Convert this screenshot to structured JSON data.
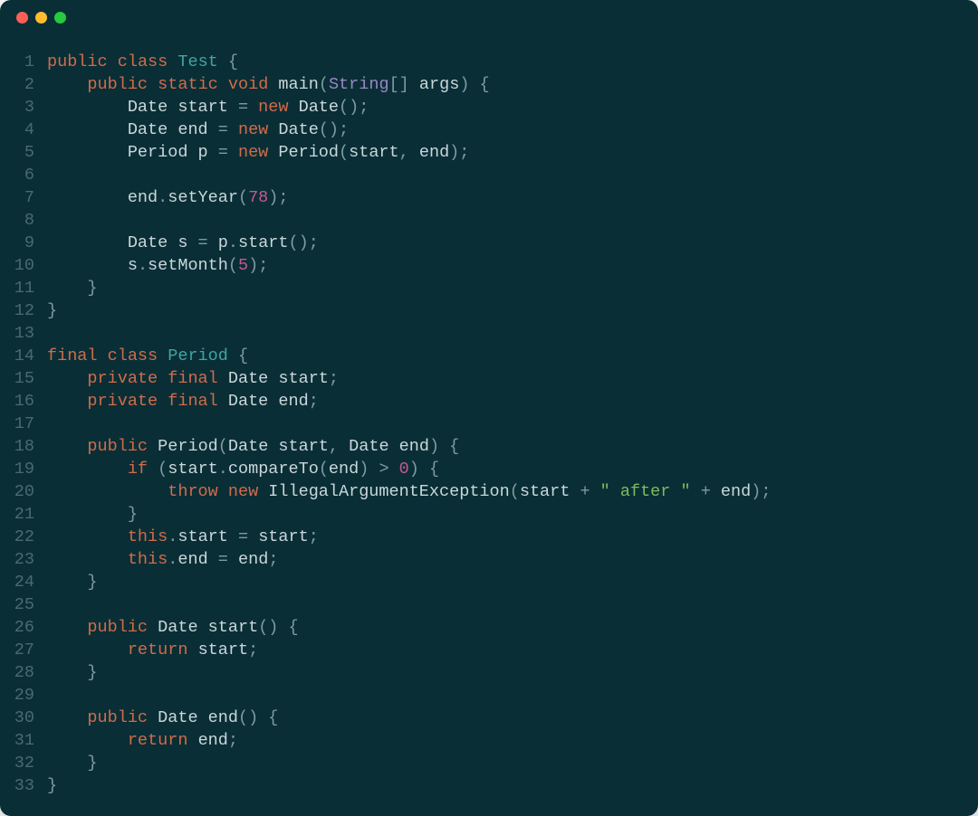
{
  "colors": {
    "bg": "#0a2e36",
    "gutter": "#4a6a72",
    "text": "#c9d7da",
    "keyword": "#d06c4a",
    "type": "#3fa5a3",
    "type2": "#9a87c4",
    "punct": "#7f9ba1",
    "number": "#c55a8a",
    "string": "#7bbd5d",
    "dot_red": "#ff5f56",
    "dot_yellow": "#ffbd2e",
    "dot_green": "#27c93f"
  },
  "code_lines": [
    {
      "n": "1",
      "tokens": [
        [
          "kw",
          "public"
        ],
        [
          "",
          ""
        ],
        [
          "punc",
          " "
        ],
        [
          "kw",
          "class"
        ],
        [
          "punc",
          " "
        ],
        [
          "type",
          "Test"
        ],
        [
          "punc",
          " {"
        ]
      ]
    },
    {
      "n": "2",
      "tokens": [
        [
          "",
          "    "
        ],
        [
          "kw",
          "public"
        ],
        [
          "punc",
          " "
        ],
        [
          "kw",
          "static"
        ],
        [
          "punc",
          " "
        ],
        [
          "kw",
          "void"
        ],
        [
          "punc",
          " "
        ],
        [
          "ident",
          "main"
        ],
        [
          "punc",
          "("
        ],
        [
          "type2",
          "String"
        ],
        [
          "punc",
          "[] "
        ],
        [
          "ident",
          "args"
        ],
        [
          "punc",
          ") {"
        ]
      ]
    },
    {
      "n": "3",
      "tokens": [
        [
          "",
          "        "
        ],
        [
          "ident",
          "Date start "
        ],
        [
          "punc",
          "= "
        ],
        [
          "kw",
          "new"
        ],
        [
          "punc",
          " "
        ],
        [
          "ident",
          "Date"
        ],
        [
          "punc",
          "();"
        ]
      ]
    },
    {
      "n": "4",
      "tokens": [
        [
          "",
          "        "
        ],
        [
          "ident",
          "Date end "
        ],
        [
          "punc",
          "= "
        ],
        [
          "kw",
          "new"
        ],
        [
          "punc",
          " "
        ],
        [
          "ident",
          "Date"
        ],
        [
          "punc",
          "();"
        ]
      ]
    },
    {
      "n": "5",
      "tokens": [
        [
          "",
          "        "
        ],
        [
          "ident",
          "Period p "
        ],
        [
          "punc",
          "= "
        ],
        [
          "kw",
          "new"
        ],
        [
          "punc",
          " "
        ],
        [
          "ident",
          "Period"
        ],
        [
          "punc",
          "("
        ],
        [
          "ident",
          "start"
        ],
        [
          "punc",
          ", "
        ],
        [
          "ident",
          "end"
        ],
        [
          "punc",
          ");"
        ]
      ]
    },
    {
      "n": "6",
      "tokens": [
        [
          "",
          ""
        ]
      ]
    },
    {
      "n": "7",
      "tokens": [
        [
          "",
          "        "
        ],
        [
          "ident",
          "end"
        ],
        [
          "punc",
          "."
        ],
        [
          "ident",
          "setYear"
        ],
        [
          "punc",
          "("
        ],
        [
          "num",
          "78"
        ],
        [
          "punc",
          ");"
        ]
      ]
    },
    {
      "n": "8",
      "tokens": [
        [
          "",
          ""
        ]
      ]
    },
    {
      "n": "9",
      "tokens": [
        [
          "",
          "        "
        ],
        [
          "ident",
          "Date s "
        ],
        [
          "punc",
          "= "
        ],
        [
          "ident",
          "p"
        ],
        [
          "punc",
          "."
        ],
        [
          "ident",
          "start"
        ],
        [
          "punc",
          "();"
        ]
      ]
    },
    {
      "n": "10",
      "tokens": [
        [
          "",
          "        "
        ],
        [
          "ident",
          "s"
        ],
        [
          "punc",
          "."
        ],
        [
          "ident",
          "setMonth"
        ],
        [
          "punc",
          "("
        ],
        [
          "num",
          "5"
        ],
        [
          "punc",
          ");"
        ]
      ]
    },
    {
      "n": "11",
      "tokens": [
        [
          "",
          "    "
        ],
        [
          "punc",
          "}"
        ]
      ]
    },
    {
      "n": "12",
      "tokens": [
        [
          "punc",
          "}"
        ]
      ]
    },
    {
      "n": "13",
      "tokens": [
        [
          "",
          ""
        ]
      ]
    },
    {
      "n": "14",
      "tokens": [
        [
          "kw",
          "final"
        ],
        [
          "punc",
          " "
        ],
        [
          "kw",
          "class"
        ],
        [
          "punc",
          " "
        ],
        [
          "type",
          "Period"
        ],
        [
          "punc",
          " {"
        ]
      ]
    },
    {
      "n": "15",
      "tokens": [
        [
          "",
          "    "
        ],
        [
          "kw",
          "private"
        ],
        [
          "punc",
          " "
        ],
        [
          "kw",
          "final"
        ],
        [
          "punc",
          " "
        ],
        [
          "ident",
          "Date start"
        ],
        [
          "punc",
          ";"
        ]
      ]
    },
    {
      "n": "16",
      "tokens": [
        [
          "",
          "    "
        ],
        [
          "kw",
          "private"
        ],
        [
          "punc",
          " "
        ],
        [
          "kw",
          "final"
        ],
        [
          "punc",
          " "
        ],
        [
          "ident",
          "Date end"
        ],
        [
          "punc",
          ";"
        ]
      ]
    },
    {
      "n": "17",
      "tokens": [
        [
          "",
          ""
        ]
      ]
    },
    {
      "n": "18",
      "tokens": [
        [
          "",
          "    "
        ],
        [
          "kw",
          "public"
        ],
        [
          "punc",
          " "
        ],
        [
          "ident",
          "Period"
        ],
        [
          "punc",
          "("
        ],
        [
          "ident",
          "Date start"
        ],
        [
          "punc",
          ", "
        ],
        [
          "ident",
          "Date end"
        ],
        [
          "punc",
          ") {"
        ]
      ]
    },
    {
      "n": "19",
      "tokens": [
        [
          "",
          "        "
        ],
        [
          "kw",
          "if"
        ],
        [
          "punc",
          " ("
        ],
        [
          "ident",
          "start"
        ],
        [
          "punc",
          "."
        ],
        [
          "ident",
          "compareTo"
        ],
        [
          "punc",
          "("
        ],
        [
          "ident",
          "end"
        ],
        [
          "punc",
          ") > "
        ],
        [
          "num",
          "0"
        ],
        [
          "punc",
          ") {"
        ]
      ]
    },
    {
      "n": "20",
      "tokens": [
        [
          "",
          "            "
        ],
        [
          "kw",
          "throw"
        ],
        [
          "punc",
          " "
        ],
        [
          "kw",
          "new"
        ],
        [
          "punc",
          " "
        ],
        [
          "ident",
          "IllegalArgumentException"
        ],
        [
          "punc",
          "("
        ],
        [
          "ident",
          "start"
        ],
        [
          "punc",
          " + "
        ],
        [
          "str",
          "\" after \""
        ],
        [
          "punc",
          " + "
        ],
        [
          "ident",
          "end"
        ],
        [
          "punc",
          ");"
        ]
      ]
    },
    {
      "n": "21",
      "tokens": [
        [
          "",
          "        "
        ],
        [
          "punc",
          "}"
        ]
      ]
    },
    {
      "n": "22",
      "tokens": [
        [
          "",
          "        "
        ],
        [
          "kw",
          "this"
        ],
        [
          "punc",
          "."
        ],
        [
          "ident",
          "start "
        ],
        [
          "punc",
          "= "
        ],
        [
          "ident",
          "start"
        ],
        [
          "punc",
          ";"
        ]
      ]
    },
    {
      "n": "23",
      "tokens": [
        [
          "",
          "        "
        ],
        [
          "kw",
          "this"
        ],
        [
          "punc",
          "."
        ],
        [
          "ident",
          "end "
        ],
        [
          "punc",
          "= "
        ],
        [
          "ident",
          "end"
        ],
        [
          "punc",
          ";"
        ]
      ]
    },
    {
      "n": "24",
      "tokens": [
        [
          "",
          "    "
        ],
        [
          "punc",
          "}"
        ]
      ]
    },
    {
      "n": "25",
      "tokens": [
        [
          "",
          ""
        ]
      ]
    },
    {
      "n": "26",
      "tokens": [
        [
          "",
          "    "
        ],
        [
          "kw",
          "public"
        ],
        [
          "punc",
          " "
        ],
        [
          "ident",
          "Date "
        ],
        [
          "ident",
          "start"
        ],
        [
          "punc",
          "() {"
        ]
      ]
    },
    {
      "n": "27",
      "tokens": [
        [
          "",
          "        "
        ],
        [
          "kw",
          "return"
        ],
        [
          "punc",
          " "
        ],
        [
          "ident",
          "start"
        ],
        [
          "punc",
          ";"
        ]
      ]
    },
    {
      "n": "28",
      "tokens": [
        [
          "",
          "    "
        ],
        [
          "punc",
          "}"
        ]
      ]
    },
    {
      "n": "29",
      "tokens": [
        [
          "",
          ""
        ]
      ]
    },
    {
      "n": "30",
      "tokens": [
        [
          "",
          "    "
        ],
        [
          "kw",
          "public"
        ],
        [
          "punc",
          " "
        ],
        [
          "ident",
          "Date "
        ],
        [
          "ident",
          "end"
        ],
        [
          "punc",
          "() {"
        ]
      ]
    },
    {
      "n": "31",
      "tokens": [
        [
          "",
          "        "
        ],
        [
          "kw",
          "return"
        ],
        [
          "punc",
          " "
        ],
        [
          "ident",
          "end"
        ],
        [
          "punc",
          ";"
        ]
      ]
    },
    {
      "n": "32",
      "tokens": [
        [
          "",
          "    "
        ],
        [
          "punc",
          "}"
        ]
      ]
    },
    {
      "n": "33",
      "tokens": [
        [
          "punc",
          "}"
        ]
      ]
    }
  ]
}
